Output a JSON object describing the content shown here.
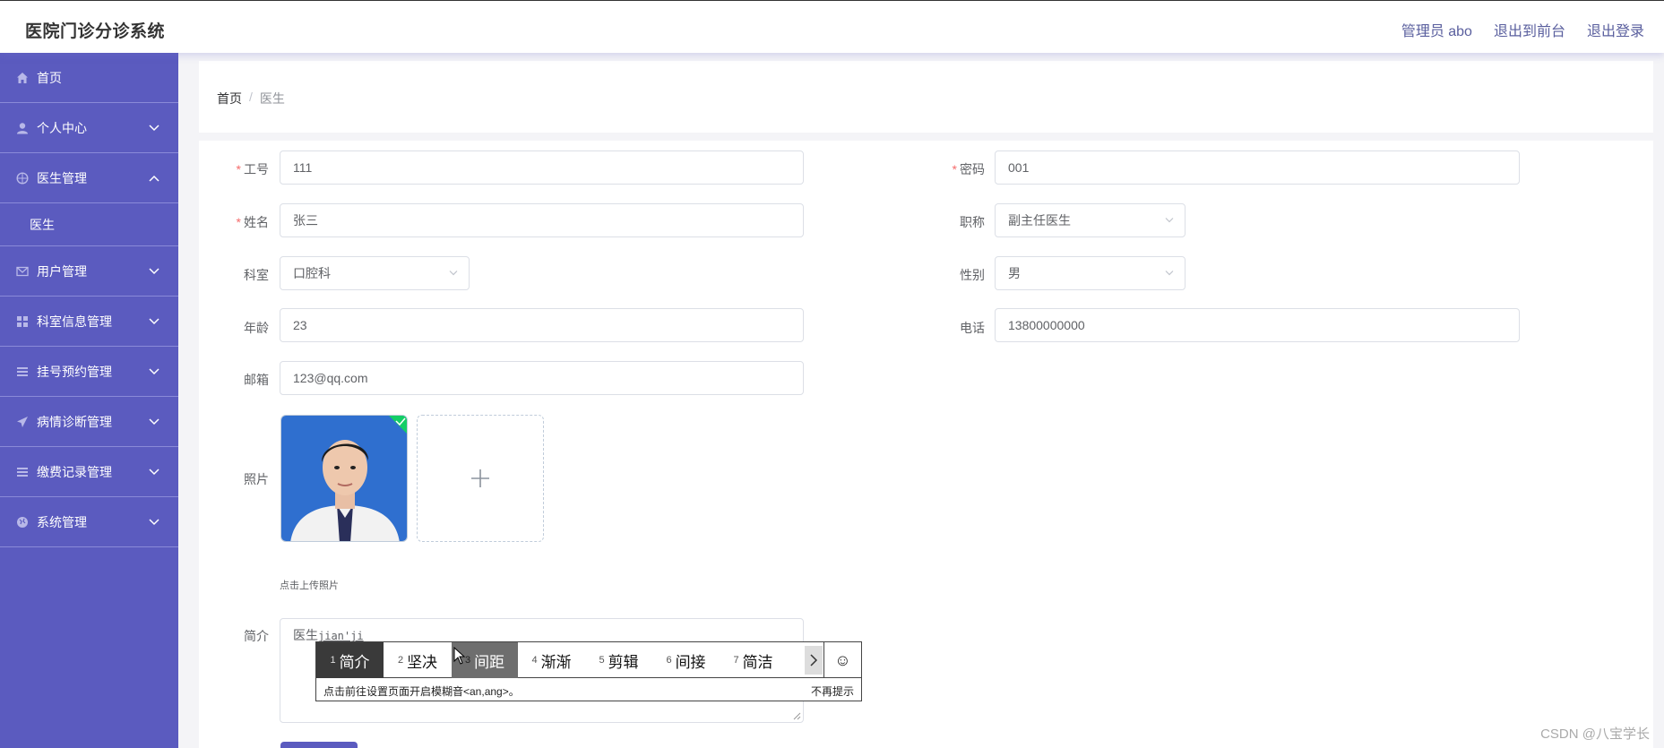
{
  "header": {
    "title": "医院门诊分诊系统",
    "admin": "管理员 abo",
    "back_front": "退出到前台",
    "logout": "退出登录"
  },
  "sidebar": {
    "items": [
      {
        "label": "首页",
        "icon": "home-icon"
      },
      {
        "label": "个人中心",
        "icon": "user-icon"
      },
      {
        "label": "医生管理",
        "icon": "compass-icon",
        "expanded": true
      },
      {
        "label": "医生",
        "sub": true
      },
      {
        "label": "用户管理",
        "icon": "mail-icon"
      },
      {
        "label": "科室信息管理",
        "icon": "grid-icon"
      },
      {
        "label": "挂号预约管理",
        "icon": "list-icon"
      },
      {
        "label": "病情诊断管理",
        "icon": "send-icon"
      },
      {
        "label": "缴费记录管理",
        "icon": "list-icon"
      },
      {
        "label": "系统管理",
        "icon": "globe-icon"
      }
    ]
  },
  "breadcrumb": {
    "home": "首页",
    "sep": "/",
    "current": "医生"
  },
  "form": {
    "gonghao": {
      "label": "工号",
      "value": "111"
    },
    "mima": {
      "label": "密码",
      "value": "001"
    },
    "xingming": {
      "label": "姓名",
      "value": "张三"
    },
    "zhicheng": {
      "label": "职称",
      "value": "副主任医生"
    },
    "keshi": {
      "label": "科室",
      "value": "口腔科"
    },
    "xingbie": {
      "label": "性别",
      "value": "男"
    },
    "nianling": {
      "label": "年龄",
      "value": "23"
    },
    "dianhua": {
      "label": "电话",
      "value": "13800000000"
    },
    "youxiang": {
      "label": "邮箱",
      "value": "123@qq.com"
    },
    "zhaopian": {
      "label": "照片",
      "tip": "点击上传照片"
    },
    "jianjie": {
      "label": "简介",
      "value": "医生",
      "composing": "jian'ji"
    }
  },
  "ime": {
    "candidates": [
      {
        "num": "1",
        "text": "简介"
      },
      {
        "num": "2",
        "text": "坚决"
      },
      {
        "num": "3",
        "text": "间距"
      },
      {
        "num": "4",
        "text": "渐渐"
      },
      {
        "num": "5",
        "text": "剪辑"
      },
      {
        "num": "6",
        "text": "间接"
      },
      {
        "num": "7",
        "text": "简洁"
      }
    ],
    "hint": "点击前往设置页面开启模糊音<an,ang>。",
    "no_hint": "不再提示",
    "emoji": "☺"
  },
  "watermark": "CSDN @八宝学长",
  "colors": {
    "sidebar": "#5b5bbf",
    "accent": "#5a5f9e",
    "required": "#f56c6c",
    "success": "#13ce66"
  }
}
